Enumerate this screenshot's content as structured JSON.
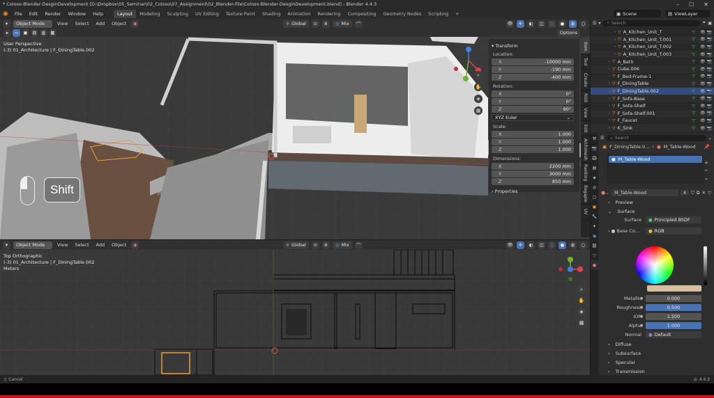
{
  "window": {
    "title": "* Coloso-Blender-DesginDevelopment [D:\\Dropbox\\05_Seminar\\02_Coloso\\07_Assignment\\02_Blender-File\\Coloso-Blender-DesginDevelopment.blend] - Blender 4.4.3",
    "minimize": "–",
    "maximize": "☐",
    "close": "✕"
  },
  "menubar": {
    "menus": [
      "File",
      "Edit",
      "Render",
      "Window",
      "Help"
    ],
    "workspaces": [
      "Layout",
      "Modeling",
      "Sculpting",
      "UV Editing",
      "Texture Paint",
      "Shading",
      "Animation",
      "Rendering",
      "Compositing",
      "Geometry Nodes",
      "Scripting"
    ],
    "active_workspace": "Layout",
    "add_tab": "+",
    "scene": "Scene",
    "view_layer": "ViewLayer"
  },
  "viewport_top": {
    "mode": "Object Mode",
    "menus": [
      "View",
      "Select",
      "Add",
      "Object"
    ],
    "orientation": "Global",
    "shading_mix": "Mix",
    "options_label": "Options",
    "view_name": "User Perspective",
    "collection_info": "(-3) 01_Architecture | F_DiningTable.002",
    "keycap_label": "Shift"
  },
  "npanel": {
    "transform_label": "Transform",
    "location_label": "Location:",
    "location": [
      {
        "axis": "X",
        "value": "-10000 mm"
      },
      {
        "axis": "Y",
        "value": "-190 mm"
      },
      {
        "axis": "Z",
        "value": "-400 mm"
      }
    ],
    "rotation_label": "Rotation:",
    "rotation": [
      {
        "axis": "X",
        "value": "0°"
      },
      {
        "axis": "Y",
        "value": "0°"
      },
      {
        "axis": "Z",
        "value": "90°"
      }
    ],
    "rotation_mode": "XYZ Euler",
    "scale_label": "Scale:",
    "scale": [
      {
        "axis": "X",
        "value": "1.000"
      },
      {
        "axis": "Y",
        "value": "1.000"
      },
      {
        "axis": "Z",
        "value": "1.000"
      }
    ],
    "dimensions_label": "Dimensions:",
    "dimensions": [
      {
        "axis": "X",
        "value": "2200 mm"
      },
      {
        "axis": "Y",
        "value": "3000 mm"
      },
      {
        "axis": "Z",
        "value": "850 mm"
      }
    ],
    "properties_label": "Properties"
  },
  "sidetabs": [
    "Item",
    "Tool",
    "Create",
    "RGB",
    "View",
    "Edit",
    "Archimesh",
    "Ranking",
    "Bagapie",
    "UV"
  ],
  "viewport_bottom": {
    "mode": "Object Mode",
    "menus": [
      "View",
      "Select",
      "Add",
      "Object"
    ],
    "orientation": "Global",
    "shading_mix": "Mix",
    "view_name": "Top Orthographic",
    "collection_info": "(-3) 01_Architecture | F_DiningTable.002",
    "units": "Meters"
  },
  "outliner": {
    "search_placeholder": "Search",
    "items": [
      {
        "name": "A_Kitchen_Unit_T",
        "depth": 2
      },
      {
        "name": "A_Kitchen_Unit_T.001",
        "depth": 2
      },
      {
        "name": "A_Kitchen_Unit_T.002",
        "depth": 2
      },
      {
        "name": "A_Kitchen_Unit_T.003",
        "depth": 2
      },
      {
        "name": "A_Bath",
        "depth": 1
      },
      {
        "name": "Cube.006",
        "depth": 1
      },
      {
        "name": "F_Bed-Frame-1",
        "depth": 1
      },
      {
        "name": "F_DiningTable",
        "depth": 1
      },
      {
        "name": "F_DiningTable.002",
        "depth": 1,
        "selected": true
      },
      {
        "name": "F_Sofa-Base",
        "depth": 1
      },
      {
        "name": "F_Sofa-Shelf",
        "depth": 1
      },
      {
        "name": "F_Sofa-Shelf.001",
        "depth": 1
      },
      {
        "name": "F_Faucet",
        "depth": 1
      },
      {
        "name": "K_Sink",
        "depth": 1
      }
    ]
  },
  "properties": {
    "search_placeholder": "Search",
    "object_name": "F_DiningTable.0...",
    "material_slot": "M_Table-Wood",
    "material_list_item": "M_Table-Wood",
    "material_name": "M_Table-Wood",
    "user_count": "4",
    "preview_label": "Preview",
    "surface_label": "Surface",
    "surface_field": "Surface",
    "surface_value": "Principled BSDF",
    "base_color_label": "Base Co...",
    "base_color_value": "RGB",
    "base_color_hex": "#d8bea0",
    "params": [
      {
        "label": "Metallic",
        "value": "0.000",
        "blue": false
      },
      {
        "label": "Roughness",
        "value": "0.500",
        "blue": true
      },
      {
        "label": "IOR",
        "value": "1.500",
        "blue": false
      },
      {
        "label": "Alpha",
        "value": "1.000",
        "blue": true
      }
    ],
    "normal_label": "Normal",
    "normal_value": "Default",
    "panels": [
      "Diffuse",
      "Subsurface",
      "Specular",
      "Transmission"
    ]
  },
  "statusbar": {
    "left": "Cancel",
    "right": "4.4.3"
  },
  "colors": {
    "accent": "#4772b3",
    "selection": "#334d80",
    "object_orange": "#e6a040",
    "mesh_green": "#50c878",
    "axis_x": "#e0404a",
    "axis_y": "#70b030",
    "axis_z": "#4080e0"
  }
}
